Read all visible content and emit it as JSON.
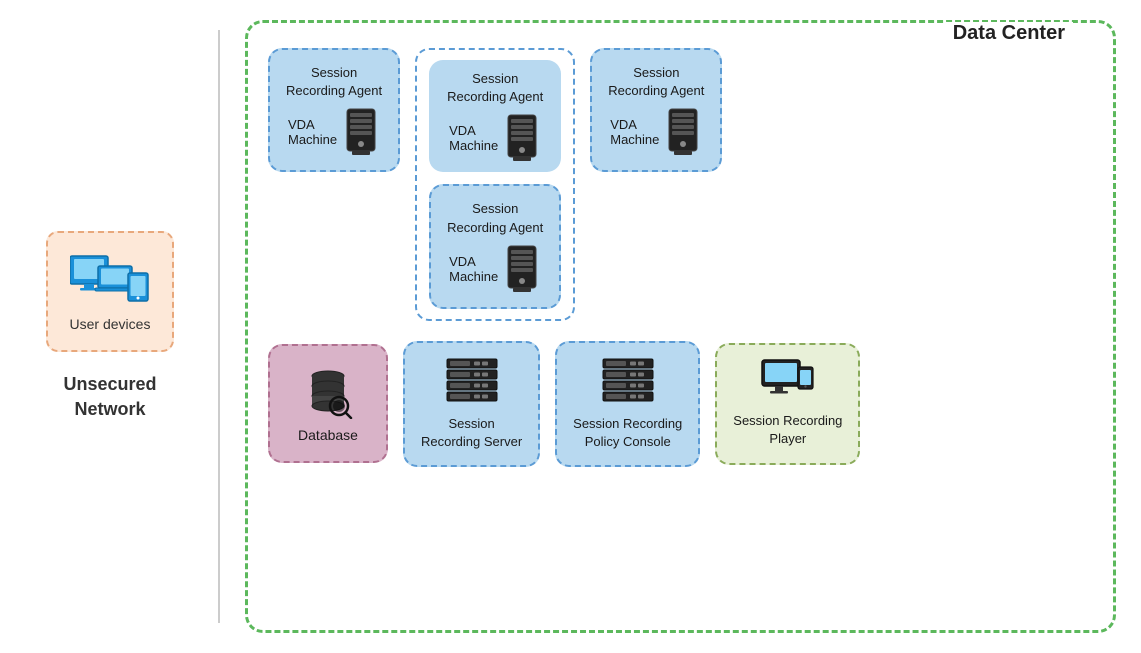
{
  "left": {
    "unsecured_network_label": "Unsecured\nNetwork",
    "user_devices_label": "User devices"
  },
  "right": {
    "data_center_title": "Data Center",
    "vda_agents": [
      {
        "agent_text": "Session\nRecording Agent",
        "machine_text": "VDA\nMachine"
      },
      {
        "agent_text": "Session\nRecording Agent",
        "machine_text": "VDA\nMachine"
      },
      {
        "agent_text": "Session\nRecording Agent",
        "machine_text": "VDA\nMachine"
      },
      {
        "agent_text": "Session\nRecording Agent",
        "machine_text": "VDA\nMachine"
      }
    ],
    "database_label": "Database",
    "session_recording_server_label": "Session\nRecording Server",
    "policy_console_label": "Session Recording\nPolicy Console",
    "player_label": "Session Recording\nPlayer"
  }
}
